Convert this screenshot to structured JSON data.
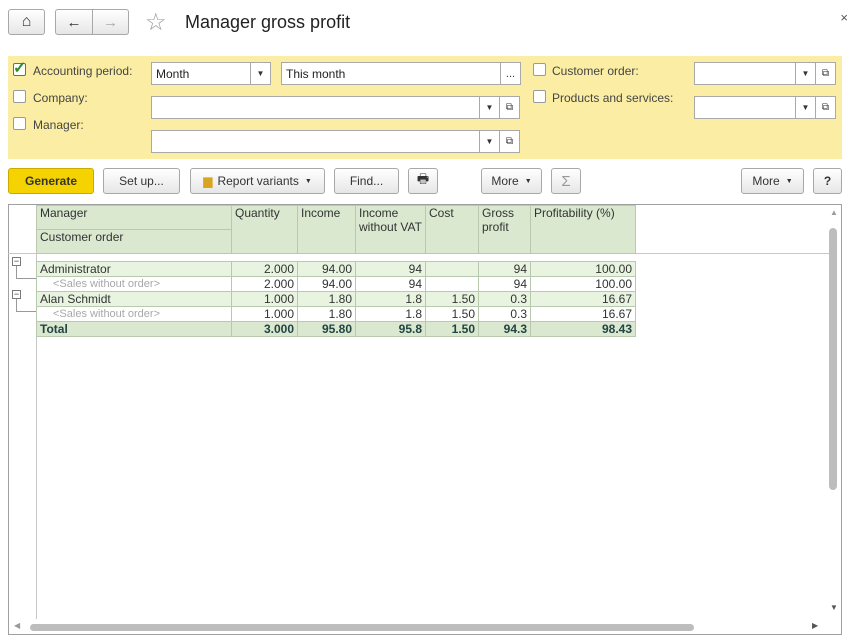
{
  "window": {
    "title": "Manager gross profit",
    "close_glyph": "×"
  },
  "nav": {
    "home_icon": "⌂",
    "back_icon": "←",
    "forward_icon": "→",
    "star_icon": "☆"
  },
  "filters": {
    "accounting_period": {
      "label": "Accounting period:",
      "checked": true,
      "period_type": "Month",
      "period_value": "This month",
      "ellipsis": "..."
    },
    "company": {
      "label": "Company:",
      "checked": false,
      "value": ""
    },
    "manager": {
      "label": "Manager:",
      "checked": false,
      "value": ""
    },
    "customer_order": {
      "label": "Customer order:",
      "checked": false,
      "value": ""
    },
    "products_services": {
      "label": "Products and services:",
      "checked": false,
      "value": ""
    }
  },
  "toolbar": {
    "generate": "Generate",
    "setup": "Set up...",
    "report_variants": "Report variants",
    "find": "Find...",
    "more1": "More",
    "sigma": "Σ",
    "more2": "More",
    "help": "?"
  },
  "report": {
    "headers": {
      "manager": "Manager",
      "customer_order": "Customer order",
      "quantity": "Quantity",
      "income": "Income",
      "income_wo_vat": "Income without VAT",
      "cost": "Cost",
      "gross_profit": "Gross profit",
      "profitability": "Profitability (%)"
    },
    "rows": [
      {
        "name": "Administrator",
        "quantity": "2.000",
        "income": "94.00",
        "income_wo_vat": "94",
        "cost": "",
        "gross_profit": "94",
        "profitability": "100.00",
        "sub": {
          "name": "<Sales without order>",
          "quantity": "2.000",
          "income": "94.00",
          "income_wo_vat": "94",
          "cost": "",
          "gross_profit": "94",
          "profitability": "100.00"
        }
      },
      {
        "name": "Alan Schmidt",
        "quantity": "1.000",
        "income": "1.80",
        "income_wo_vat": "1.8",
        "cost": "1.50",
        "gross_profit": "0.3",
        "profitability": "16.67",
        "sub": {
          "name": "<Sales without order>",
          "quantity": "1.000",
          "income": "1.80",
          "income_wo_vat": "1.8",
          "cost": "1.50",
          "gross_profit": "0.3",
          "profitability": "16.67"
        }
      }
    ],
    "total": {
      "name": "Total",
      "quantity": "3.000",
      "income": "95.80",
      "income_wo_vat": "95.8",
      "cost": "1.50",
      "gross_profit": "94.3",
      "profitability": "98.43"
    },
    "tree_glyph": "−"
  },
  "colors": {
    "filter_panel": "#fbeea4",
    "generate_button": "#f5d300",
    "table_header": "#d9e8cf",
    "group_row": "#e8f4e0"
  }
}
